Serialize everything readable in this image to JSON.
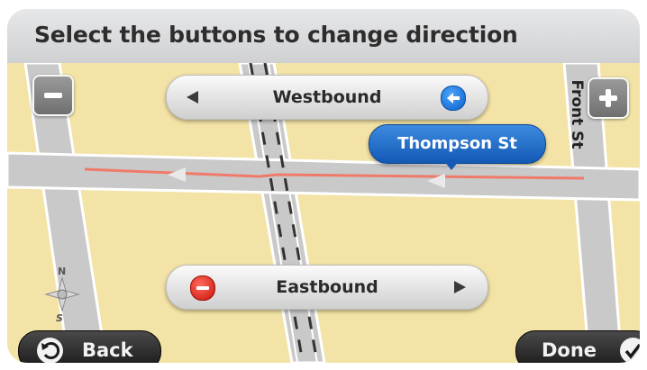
{
  "header": {
    "title": "Select the buttons to change direction"
  },
  "directions": {
    "westbound_label": "Westbound",
    "eastbound_label": "Eastbound"
  },
  "map": {
    "street_callout": "Thompson St",
    "side_street": "Front St",
    "compass_north": "N",
    "compass_south": "S"
  },
  "zoom": {
    "out_symbol": "−",
    "in_symbol": "+"
  },
  "footer": {
    "back_label": "Back",
    "done_label": "Done"
  },
  "colors": {
    "map_land": "#f4e3a6",
    "road": "#c9c9c9",
    "route_line": "#f07a6a",
    "callout_blue": "#1f6fd0",
    "stop_red": "#d5261c"
  }
}
